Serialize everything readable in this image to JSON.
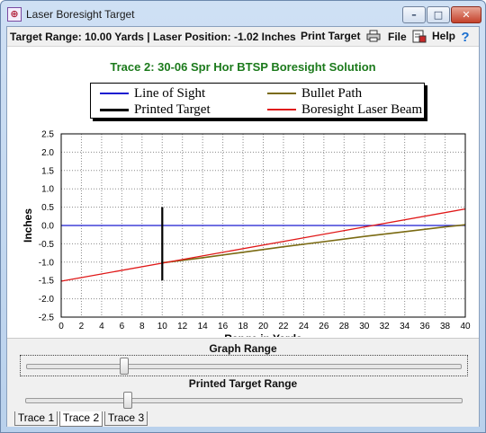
{
  "window": {
    "title": "Laser Boresight Target",
    "app_icon": "crosshair-app-icon"
  },
  "toolbar": {
    "status": "Target Range: 10.00 Yards | Laser Position: -1.02 Inches",
    "print_label": "Print Target",
    "file_label": "File",
    "help_label": "Help"
  },
  "chart_data": {
    "type": "line",
    "title": "Trace 2: 30-06 Spr Hor BTSP Boresight Solution",
    "xlabel": "Range in Yards",
    "ylabel": "Inches",
    "xlim": [
      0,
      40
    ],
    "ylim": [
      -2.5,
      2.5
    ],
    "x_ticks": [
      0,
      2,
      4,
      6,
      8,
      10,
      12,
      14,
      16,
      18,
      20,
      22,
      24,
      26,
      28,
      30,
      32,
      34,
      36,
      38,
      40
    ],
    "y_ticks": [
      "2.5",
      "2.0",
      "1.5",
      "1.0",
      "0.5",
      "0.0",
      "-0.5",
      "-1.0",
      "-1.5",
      "-2.0",
      "-2.5"
    ],
    "grid": true,
    "legend_position": "top",
    "series": [
      {
        "name": "Line of Sight",
        "color": "#1a1ad0",
        "x": [
          0,
          40
        ],
        "y": [
          0,
          0
        ]
      },
      {
        "name": "Bullet Path",
        "color": "#7a6a12",
        "x": [
          10,
          14,
          18,
          22,
          26,
          30,
          34,
          38,
          40
        ],
        "y": [
          -1.02,
          -0.88,
          -0.73,
          -0.58,
          -0.44,
          -0.3,
          -0.17,
          -0.04,
          0.02
        ]
      },
      {
        "name": "Printed Target",
        "color": "#000000",
        "x": [
          10,
          10
        ],
        "y": [
          -1.5,
          0.5
        ]
      },
      {
        "name": "Boresight Laser Beam",
        "color": "#e01818",
        "x": [
          0,
          40
        ],
        "y": [
          -1.52,
          0.45
        ]
      }
    ]
  },
  "controls": {
    "graph_range_label": "Graph Range",
    "graph_range_value": 0.22,
    "printed_target_label": "Printed Target Range",
    "printed_target_value": 0.23
  },
  "tabs": [
    "Trace 1",
    "Trace 2",
    "Trace 3"
  ]
}
